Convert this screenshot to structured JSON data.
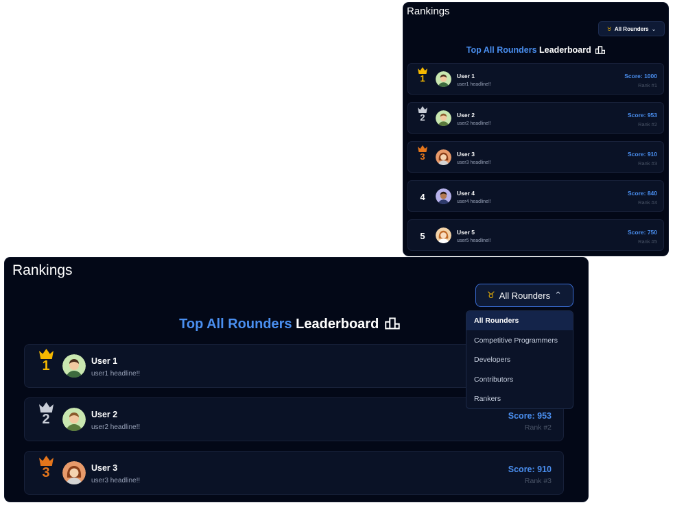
{
  "title": "Rankings",
  "filter": {
    "selected": "All Rounders"
  },
  "heading": {
    "highlight": "Top All Rounders",
    "rest": "Leaderboard"
  },
  "users": [
    {
      "rank_badge": "1",
      "name": "User 1",
      "headline": "user1 headline!!",
      "score": "Score: 1000",
      "rank": "Rank #1"
    },
    {
      "rank_badge": "2",
      "name": "User 2",
      "headline": "user2 headline!!",
      "score": "Score: 953",
      "rank": "Rank #2"
    },
    {
      "rank_badge": "3",
      "name": "User 3",
      "headline": "user3 headline!!",
      "score": "Score: 910",
      "rank": "Rank #3"
    },
    {
      "rank_badge": "4",
      "name": "User 4",
      "headline": "user4 headline!!",
      "score": "Score: 840",
      "rank": "Rank #4"
    },
    {
      "rank_badge": "5",
      "name": "User 5",
      "headline": "user5 headline!!",
      "score": "Score: 750",
      "rank": "Rank #5"
    }
  ],
  "dropdown": {
    "options": [
      "All Rounders",
      "Competitive Programmers",
      "Developers",
      "Contributors",
      "Rankers"
    ]
  },
  "colors": {
    "background": "#030817",
    "accent": "#4a8ff0",
    "gold": "#f5b800",
    "silver": "#c9ced8",
    "bronze": "#e5761c"
  }
}
